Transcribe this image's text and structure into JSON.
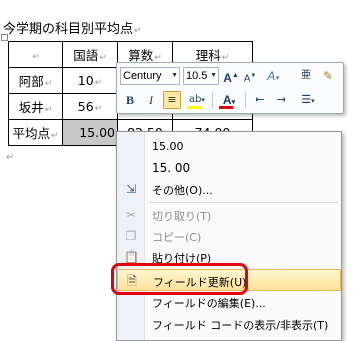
{
  "document": {
    "title": "今学期の科目別平均点",
    "para_mark": "↵",
    "table": {
      "headers": [
        "",
        "国語",
        "算数",
        "理科"
      ],
      "rows": [
        [
          "阿部",
          "10",
          "",
          ""
        ],
        [
          "坂井",
          "56",
          "",
          ""
        ],
        [
          "平均点",
          "15.00",
          "82.50",
          "74.00"
        ]
      ]
    }
  },
  "mini_toolbar": {
    "font_name": "Century",
    "font_size": "10.5",
    "row1_icons": [
      "grow-font-icon",
      "shrink-font-icon",
      "clear-format-icon",
      "phonetic-guide-icon",
      "format-painter-icon"
    ],
    "row2_icons": [
      "bold-icon",
      "italic-icon",
      "center-align-icon",
      "highlight-icon",
      "font-color-icon",
      "decrease-indent-icon",
      "increase-indent-icon",
      "bullets-icon"
    ],
    "bold": "B",
    "italic": "I",
    "font_color_glyph": "A",
    "grow_font": "A",
    "shrink_font": "A"
  },
  "context_menu": {
    "items": [
      {
        "label": "15.00",
        "icon": "",
        "disabled": false
      },
      {
        "label": "15. 00",
        "icon": "",
        "disabled": false
      },
      {
        "label": "その他(O)...",
        "icon": "insert-icon",
        "disabled": false
      },
      {
        "label": "切り取り(T)",
        "icon": "scissors-icon",
        "disabled": true
      },
      {
        "label": "コピー(C)",
        "icon": "copy-icon",
        "disabled": true
      },
      {
        "label": "貼り付け(P)",
        "icon": "paste-icon",
        "disabled": false
      },
      {
        "label": "フィールド更新(U)",
        "icon": "update-field-icon",
        "disabled": false,
        "highlighted": true
      },
      {
        "label": "フィールドの編集(E)...",
        "icon": "",
        "disabled": false
      },
      {
        "label": "フィールド コードの表示/非表示(T)",
        "icon": "",
        "disabled": false
      }
    ]
  },
  "colors": {
    "highlight": "#fde29a",
    "callout": "#e3000d",
    "selection": "#c8c8c8"
  }
}
